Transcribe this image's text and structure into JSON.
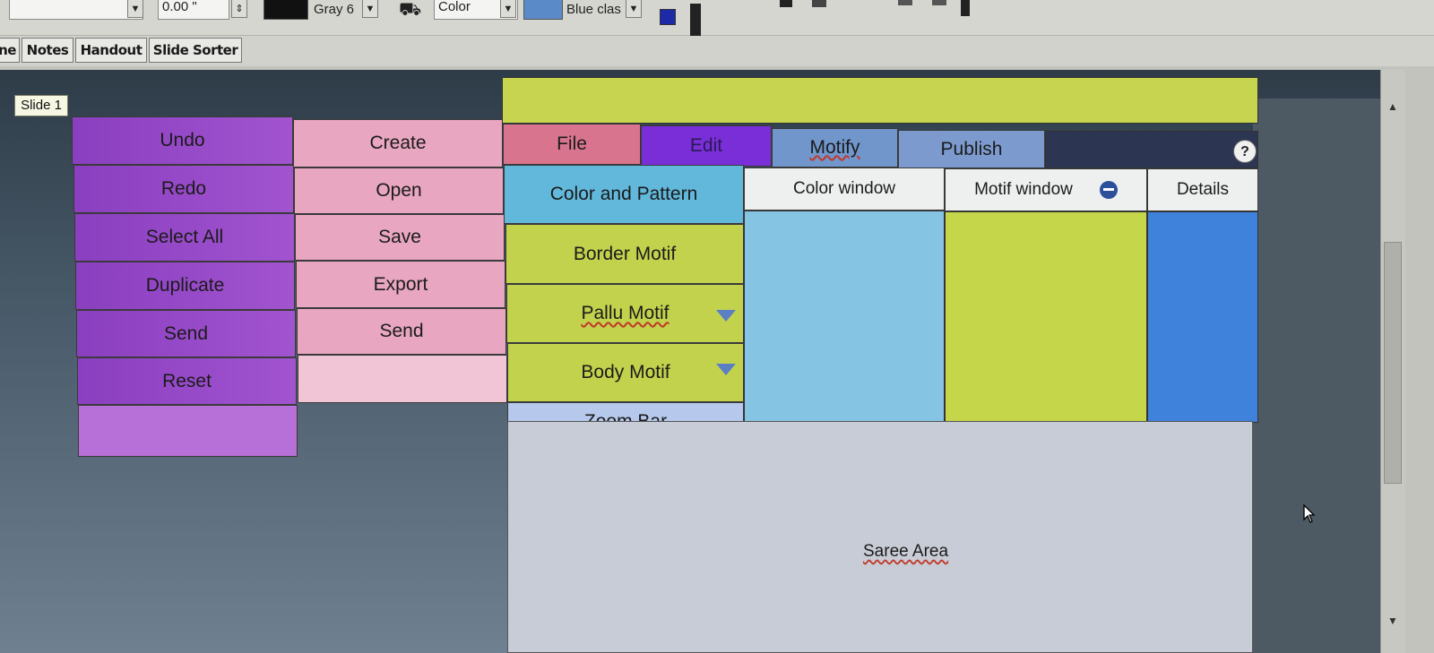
{
  "toolbar": {
    "spacing_value": "0.00 \"",
    "color_name": "Gray 6",
    "color_mode": "Color",
    "fill_name": "Blue clas"
  },
  "view_tabs": [
    "ne",
    "Notes",
    "Handout",
    "Slide Sorter"
  ],
  "slide_label": "Slide 1",
  "purple_buttons": [
    "Undo",
    "Redo",
    "Select All",
    "Duplicate",
    "Send",
    "Reset",
    ""
  ],
  "pink_buttons": [
    "Create",
    "Open",
    "Save",
    "Export",
    "Send",
    ""
  ],
  "menu": {
    "file": "File",
    "edit": "Edit",
    "motify": "Motify",
    "publish": "Publish",
    "help": "?"
  },
  "left_panel": {
    "color_pattern": "Color and Pattern",
    "border_motif": "Border Motif",
    "pallu_motif": "Pallu Motif",
    "body_motif": "Body Motif",
    "zoom_bar": "Zoom Bar"
  },
  "windows": {
    "color_window": "Color window",
    "motif_window": "Motif window",
    "details": "Details"
  },
  "saree_area": "Saree Area",
  "colors": {
    "purple": "#9a4ccb",
    "pink": "#e8a6c0",
    "yellow": "#c3d24c",
    "cyan": "#62b8db",
    "blue": "#3f82dc",
    "saree_bg": "#c8ccd6"
  }
}
